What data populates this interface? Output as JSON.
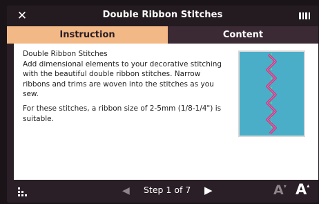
{
  "window": {
    "title": "Double Ribbon Stitches",
    "close_label": "✕"
  },
  "tabs": [
    {
      "label": "Instruction",
      "active": true
    },
    {
      "label": "Content",
      "active": false
    }
  ],
  "instruction": {
    "heading": "Double Ribbon Stitches",
    "paragraph1": "Add dimensional elements to your decorative stitching with the beautiful double ribbon stitches. Narrow ribbons and trims are woven into the stitches as you sew.",
    "paragraph2": "For these stitches, a ribbon size of 2-5mm (1/8-1/4\") is suitable."
  },
  "illustration": {
    "background_color": "#4aaec9",
    "ribbon_color": "#c23d84",
    "thread_color": "#3ddc96"
  },
  "footer": {
    "menu_icon": "grid-dots-icon",
    "prev_icon": "◀",
    "step_text": "Step 1 of 7",
    "next_icon": "▶",
    "font_decrease_icon": "A",
    "font_increase_icon": "A"
  },
  "colors": {
    "active_tab": "#f2b986",
    "window_bg": "#2a1f26"
  }
}
